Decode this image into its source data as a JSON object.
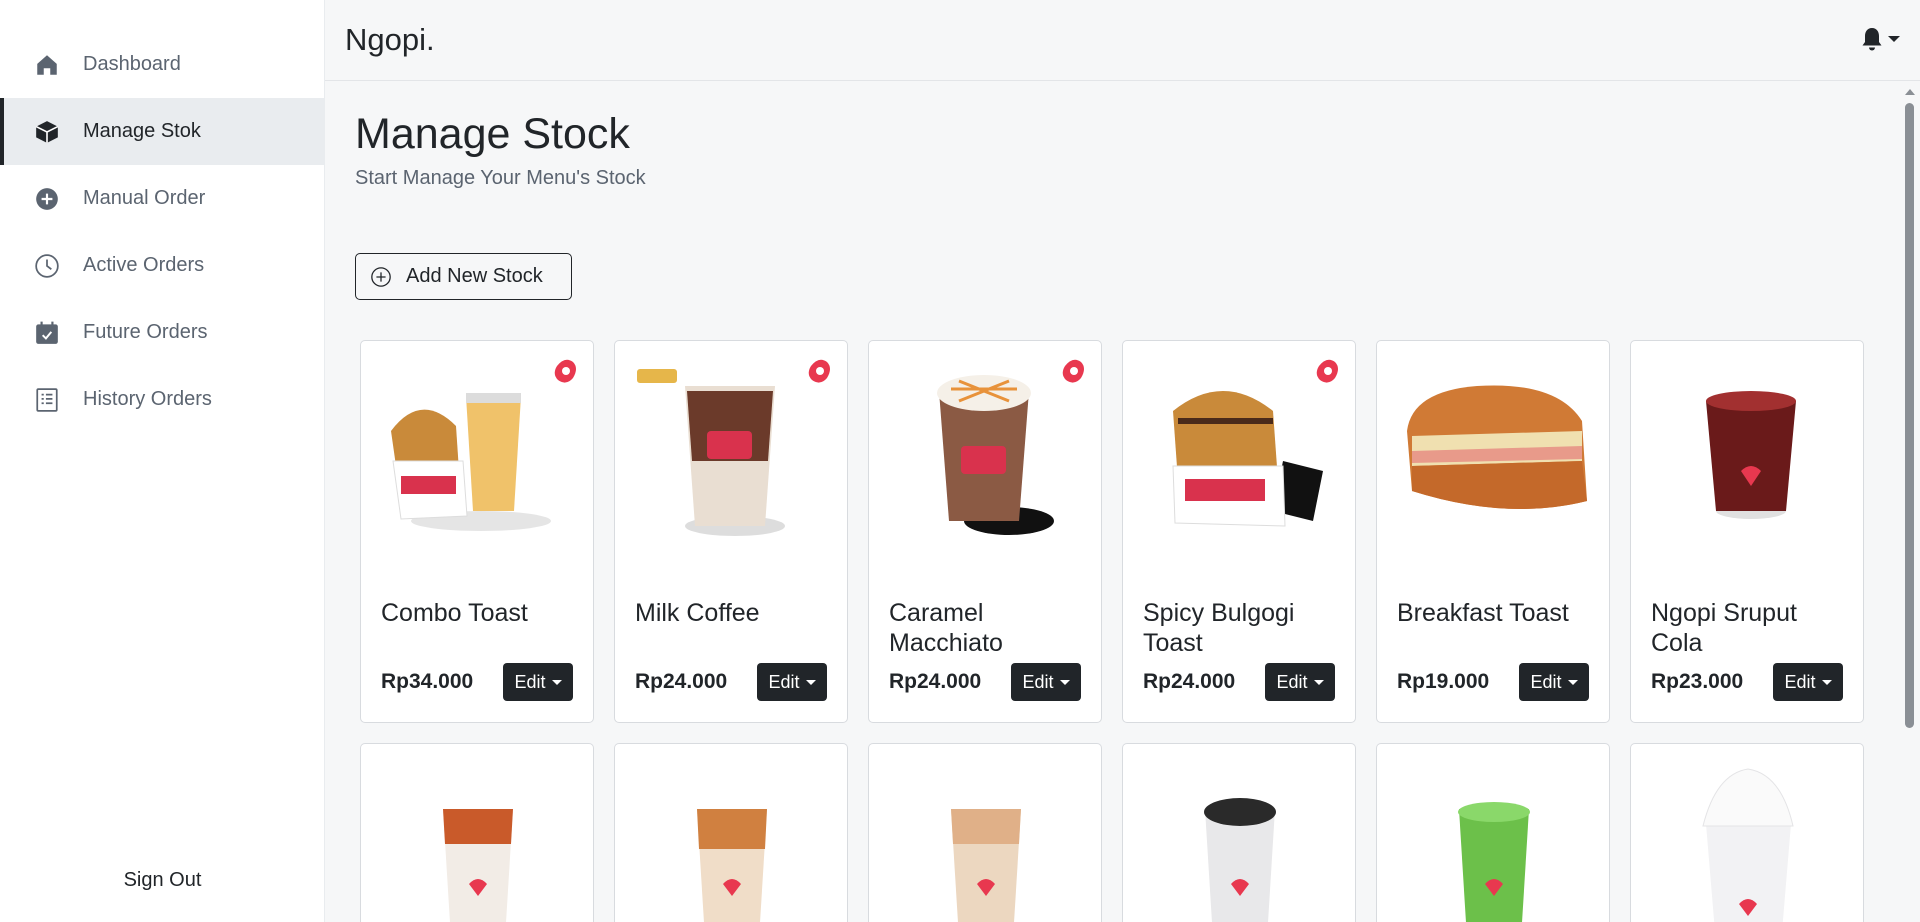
{
  "app": {
    "brand": "Ngopi."
  },
  "sidebar": {
    "items": [
      {
        "label": "Dashboard",
        "icon": "home-icon",
        "active": false
      },
      {
        "label": "Manage Stok",
        "icon": "box-icon",
        "active": true
      },
      {
        "label": "Manual Order",
        "icon": "plus-circle-icon",
        "active": false
      },
      {
        "label": "Active Orders",
        "icon": "clock-icon",
        "active": false
      },
      {
        "label": "Future Orders",
        "icon": "calendar-check-icon",
        "active": false
      },
      {
        "label": "History Orders",
        "icon": "receipt-icon",
        "active": false
      }
    ],
    "signout_label": "Sign Out"
  },
  "header": {
    "notification_icon": "bell-icon"
  },
  "main": {
    "title": "Manage Stock",
    "subtitle": "Start Manage Your Menu's Stock",
    "add_button_label": "Add New Stock",
    "edit_label": "Edit",
    "products": [
      {
        "name": "Combo Toast",
        "price": "Rp34.000"
      },
      {
        "name": "Milk Coffee",
        "price": "Rp24.000"
      },
      {
        "name": "Caramel Macchiato",
        "price": "Rp24.000"
      },
      {
        "name": "Spicy Bulgogi Toast",
        "price": "Rp24.000"
      },
      {
        "name": "Breakfast Toast",
        "price": "Rp19.000"
      },
      {
        "name": "Ngopi Sruput Cola",
        "price": "Rp23.000"
      }
    ]
  },
  "colors": {
    "accent": "#212529",
    "sidebar_active": "#e9ecef",
    "background": "#f6f7f8",
    "badge": "#e8384f"
  }
}
